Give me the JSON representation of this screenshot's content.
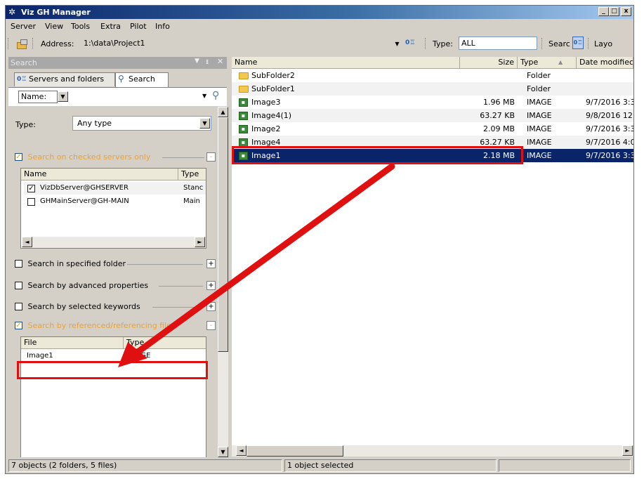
{
  "window": {
    "title": "Viz GH Manager",
    "min": "_",
    "max": "□",
    "close": "x"
  },
  "menu": [
    "Server",
    "View",
    "Tools",
    "Extra",
    "Pilot",
    "Info"
  ],
  "toolbar": {
    "address_label": "Address:",
    "address_value": "1:\\data\\Project1",
    "type_label": "Type:",
    "type_value": "ALL",
    "search_label": "Searc",
    "layout_label": "Layo"
  },
  "left_panel": {
    "header_title": "Search",
    "tabs": {
      "servers": "Servers and folders",
      "search": "Search"
    },
    "name_combo": "Name:",
    "type_label": "Type:",
    "type_value": "Any type",
    "section_servers": "Search on checked servers only",
    "servers_columns": {
      "name": "Name",
      "type": "Type"
    },
    "servers": [
      {
        "name": "VizDbServer@GHSERVER",
        "type": "Stanc",
        "checked": true
      },
      {
        "name": "GHMainServer@GH-MAIN",
        "type": "Main",
        "checked": false
      }
    ],
    "section_folder": "Search in specified folder",
    "section_advanced": "Search by advanced properties",
    "section_keywords": "Search by selected keywords",
    "section_referenced": "Search by referenced/referencing files",
    "results_columns": {
      "file": "File",
      "type": "Type"
    },
    "results": [
      {
        "file": "Image1",
        "type": "IMAGE"
      }
    ]
  },
  "file_list": {
    "columns": {
      "name": "Name",
      "size": "Size",
      "type": "Type",
      "date": "Date modifiec"
    },
    "rows": [
      {
        "name": "SubFolder2",
        "size": "",
        "type": "Folder",
        "date": "",
        "kind": "folder"
      },
      {
        "name": "SubFolder1",
        "size": "",
        "type": "Folder",
        "date": "",
        "kind": "folder"
      },
      {
        "name": "Image3",
        "size": "1.96 MB",
        "type": "IMAGE",
        "date": "9/7/2016 3:3",
        "kind": "image"
      },
      {
        "name": "Image4(1)",
        "size": "63.27 KB",
        "type": "IMAGE",
        "date": "9/8/2016 12:",
        "kind": "image"
      },
      {
        "name": "Image2",
        "size": "2.09 MB",
        "type": "IMAGE",
        "date": "9/7/2016 3:3",
        "kind": "image"
      },
      {
        "name": "Image4",
        "size": "63.27 KB",
        "type": "IMAGE",
        "date": "9/7/2016 4:0",
        "kind": "image"
      },
      {
        "name": "Image1",
        "size": "2.18 MB",
        "type": "IMAGE",
        "date": "9/7/2016 3:3",
        "kind": "image",
        "selected": true
      }
    ]
  },
  "status": {
    "objects": "7 objects (2 folders, 5 files)",
    "selected": "1 object selected"
  },
  "colors": {
    "annotation": "#e01010",
    "selection": "#0a246a",
    "accent_orange": "#e8a23a"
  }
}
